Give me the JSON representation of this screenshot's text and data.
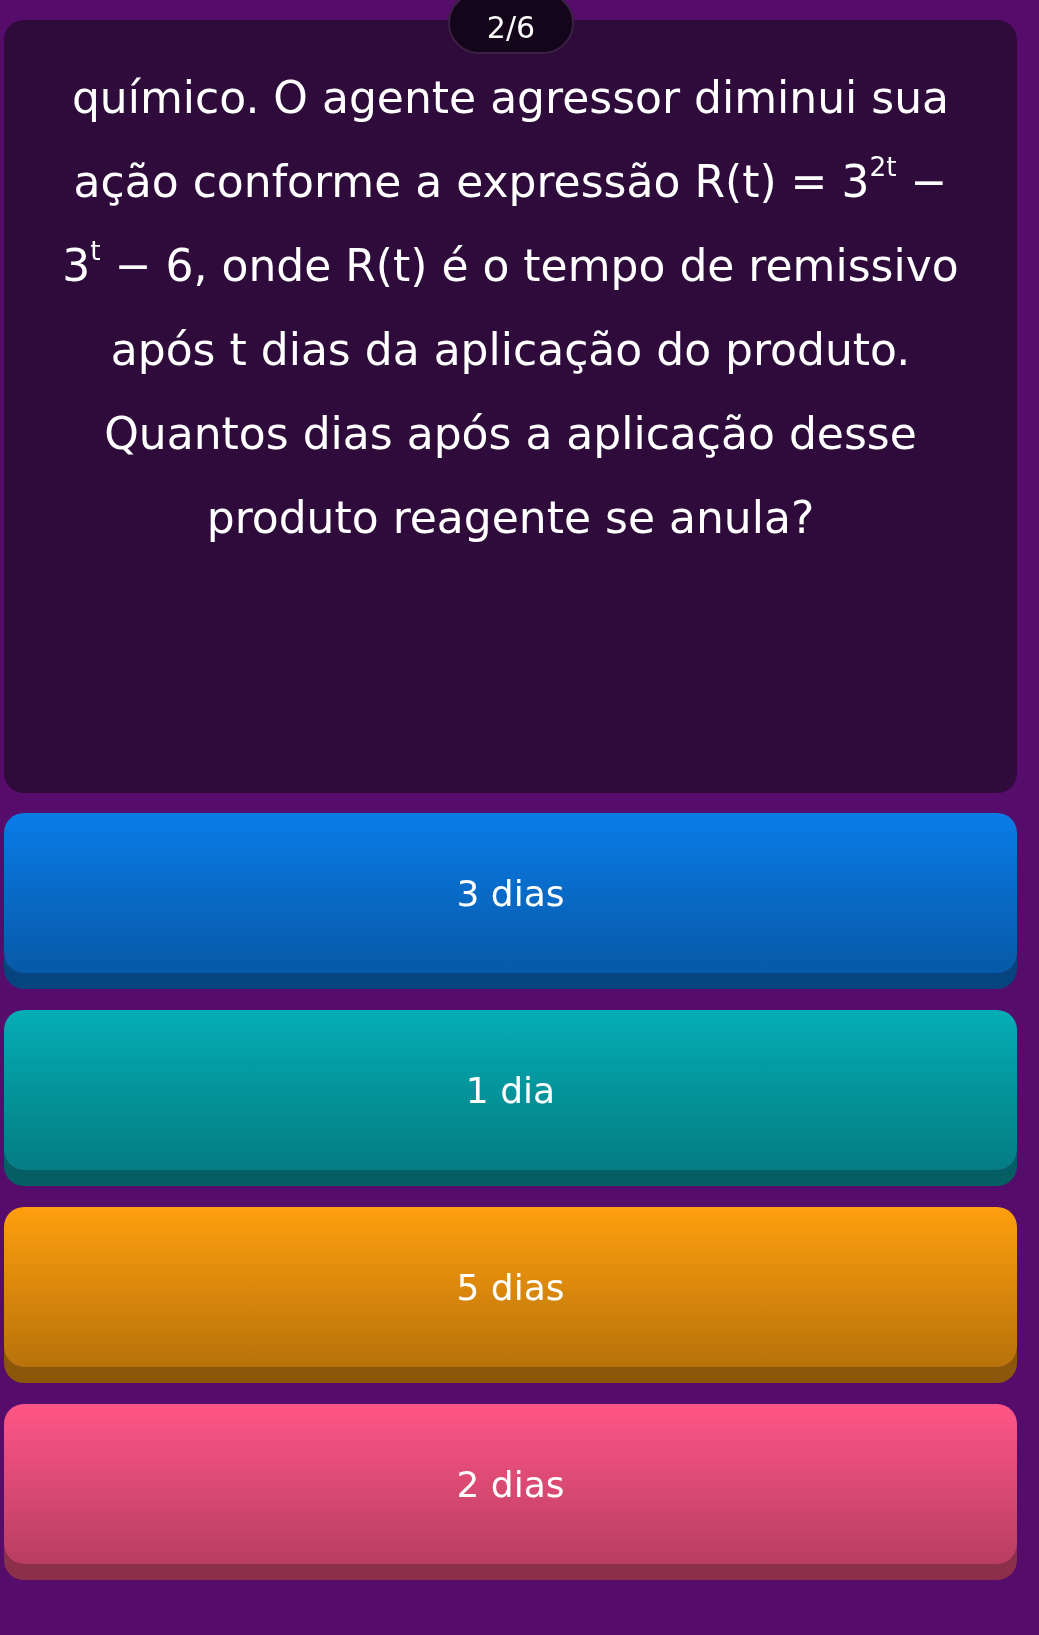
{
  "progress": "2/6",
  "question": "químico. O agente agressor diminui sua ação conforme a expressão R(t) = 3$^{2t}$ − 3$^{t}$ − 6, onde R(t) é o tempo de remissivo após t dias da aplicação do produto. Quantos dias após a aplicação desse produto reagente se anula?",
  "answers": [
    {
      "label": "3 dias",
      "color": "#0a7ce8"
    },
    {
      "label": "1 dia",
      "color": "#05adb5"
    },
    {
      "label": "5 dias",
      "color": "#ff9f0e"
    },
    {
      "label": "2 dias",
      "color": "#ff5686"
    }
  ]
}
